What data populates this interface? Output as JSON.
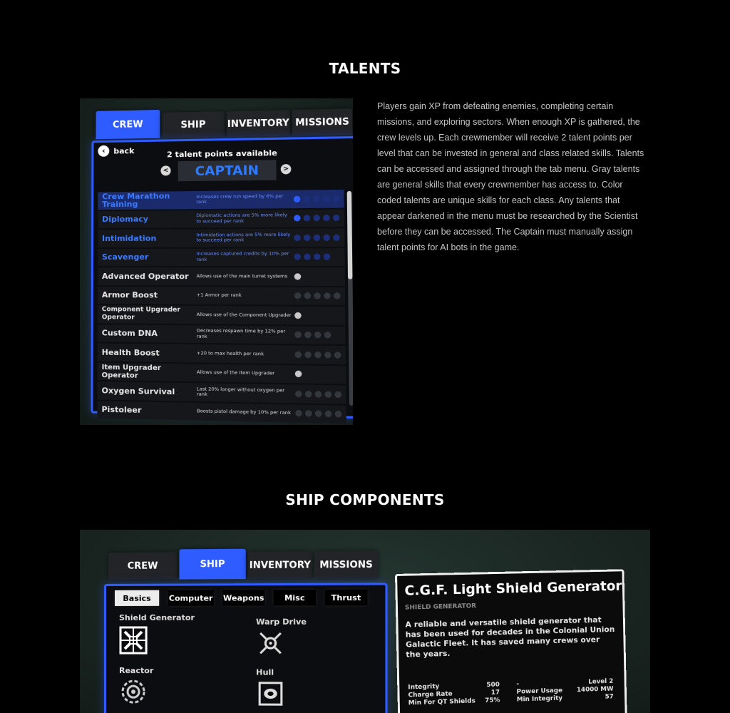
{
  "sections": {
    "talents_title": "TALENTS",
    "ship_title": "SHIP COMPONENTS"
  },
  "talents_description": "Players gain XP from defeating enemies, completing certain missions, and exploring sectors. When enough XP is gathered, the crew levels up. Each crewmember will receive 2 talent points per level that can be invested in general and class related skills. Talents can be accessed and assigned through the tab menu. Gray talents are general skills that every crewmember has access to. Color coded talents are unique skills for each class. Any talents that appear darkened in the menu must be researched by the Scientist before they can be accessed. The Captain must manually assign talent points for AI bots in the game.",
  "talents_ui": {
    "tabs": [
      "CREW",
      "SHIP",
      "INVENTORY",
      "MISSIONS"
    ],
    "back_label": "back",
    "points_text": "2 talent points available",
    "class_name": "CAPTAIN",
    "prev_arrow": "<",
    "next_arrow": ">",
    "accent_color": "#2e5cff",
    "talents": [
      {
        "name": "Crew Marathon Training",
        "desc": "Increases crew run speed by 6% per rank"
      },
      {
        "name": "Diplomacy",
        "desc": "Diplomatic actions are 5% more likely to succeed per rank"
      },
      {
        "name": "Intimidation",
        "desc": "Intimidation actions are 5% more likely to succeed per rank"
      },
      {
        "name": "Scavenger",
        "desc": "Increases captured credits by 10% per rank"
      },
      {
        "name": "Advanced Operator",
        "desc": "Allows use of the main turret systems"
      },
      {
        "name": "Armor Boost",
        "desc": "+1 Armor per rank"
      },
      {
        "name": "Component Upgrader Operator",
        "desc": "Allows use of the Component Upgrader"
      },
      {
        "name": "Custom DNA",
        "desc": "Decreases respawn time by 12% per rank"
      },
      {
        "name": "Health Boost",
        "desc": "+20 to max health per rank"
      },
      {
        "name": "Item Upgrader Operator",
        "desc": "Allows use of the Item Upgrader"
      },
      {
        "name": "Oxygen Survival",
        "desc": "Last 20% longer without oxygen per rank"
      },
      {
        "name": "Pistoleer",
        "desc": "Boosts pistol damage by 10% per rank"
      }
    ]
  },
  "ship_ui": {
    "tabs": [
      "CREW",
      "SHIP",
      "INVENTORY",
      "MISSIONS"
    ],
    "subtabs": [
      "Basics",
      "Computer",
      "Weapons",
      "Misc",
      "Thrust"
    ],
    "components": [
      "Shield Generator",
      "Warp Drive",
      "Reactor",
      "Hull"
    ],
    "card": {
      "title": "C.G.F. Light Shield Generator",
      "subtitle": "SHIELD GENERATOR",
      "text": "A reliable and versatile shield generator that has been used for decades in the Colonial Union Galactic Fleet. It has saved many crews over the years.",
      "stats_left": [
        {
          "label": "Integrity",
          "value": "500"
        },
        {
          "label": "Charge Rate",
          "value": "17"
        },
        {
          "label": "Min For QT Shields",
          "value": "75%"
        }
      ],
      "stats_right": [
        {
          "label": "-",
          "value": "Level 2"
        },
        {
          "label": "Power Usage",
          "value": "14000 MW"
        },
        {
          "label": "Min Integrity",
          "value": "57"
        }
      ]
    }
  }
}
